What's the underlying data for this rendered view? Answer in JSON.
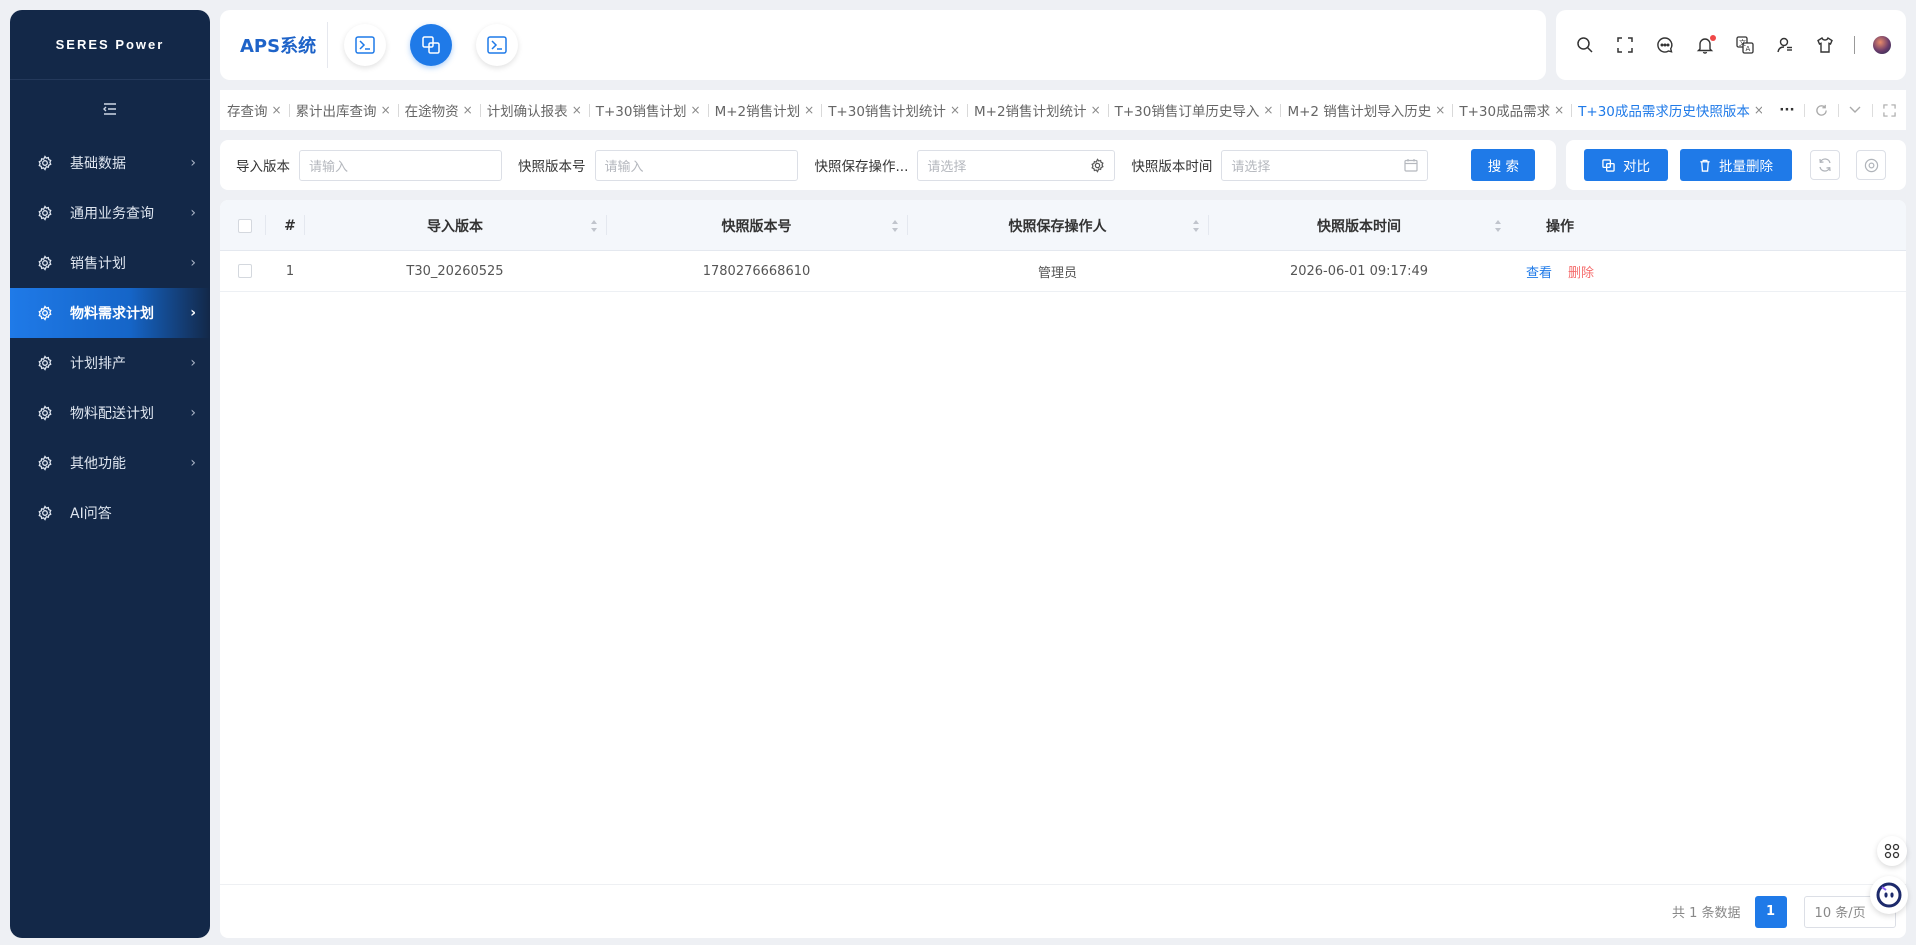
{
  "brand": "SERES Power",
  "header": {
    "system_title": "APS系统"
  },
  "sidebar": {
    "items": [
      {
        "label": "基础数据"
      },
      {
        "label": "通用业务查询"
      },
      {
        "label": "销售计划"
      },
      {
        "label": "物料需求计划"
      },
      {
        "label": "计划排产"
      },
      {
        "label": "物料配送计划"
      },
      {
        "label": "其他功能"
      },
      {
        "label": "AI问答"
      }
    ],
    "active_index": 3
  },
  "tabs": {
    "items": [
      {
        "label": "存查询"
      },
      {
        "label": "累计出库查询"
      },
      {
        "label": "在途物资"
      },
      {
        "label": "计划确认报表"
      },
      {
        "label": "T+30销售计划"
      },
      {
        "label": "M+2销售计划"
      },
      {
        "label": "T+30销售计划统计"
      },
      {
        "label": "M+2销售计划统计"
      },
      {
        "label": "T+30销售订单历史导入"
      },
      {
        "label": "M+2 销售计划导入历史"
      },
      {
        "label": "T+30成品需求"
      },
      {
        "label": "T+30成品需求历史快照版本"
      }
    ],
    "active_index": 11,
    "close_glyph": "×",
    "more": "···"
  },
  "filters": {
    "import_version_label": "导入版本",
    "import_version_placeholder": "请输入",
    "snapshot_no_label": "快照版本号",
    "snapshot_no_placeholder": "请输入",
    "operator_label": "快照保存操作...",
    "operator_placeholder": "请选择",
    "snapshot_time_label": "快照版本时间",
    "snapshot_time_placeholder": "请选择",
    "search_button": "搜 索"
  },
  "actions": {
    "compare_button": "对比",
    "batch_delete_button": "批量删除"
  },
  "table": {
    "columns": {
      "index": "#",
      "import_version": "导入版本",
      "snapshot_no": "快照版本号",
      "operator": "快照保存操作人",
      "snapshot_time": "快照版本时间",
      "actions": "操作"
    },
    "rows": [
      {
        "index": "1",
        "import_version": "T30_20260525",
        "snapshot_no": "1780276668610",
        "operator": "管理员",
        "snapshot_time": "2026-06-01 09:17:49",
        "view": "查看",
        "delete": "删除"
      }
    ]
  },
  "pagination": {
    "total_text": "共 1 条数据",
    "current_page": "1",
    "page_size": "10 条/页"
  },
  "colors": {
    "sidebar_bg": "#132848",
    "accent": "#1f7ae8",
    "danger": "#f56c6c"
  }
}
